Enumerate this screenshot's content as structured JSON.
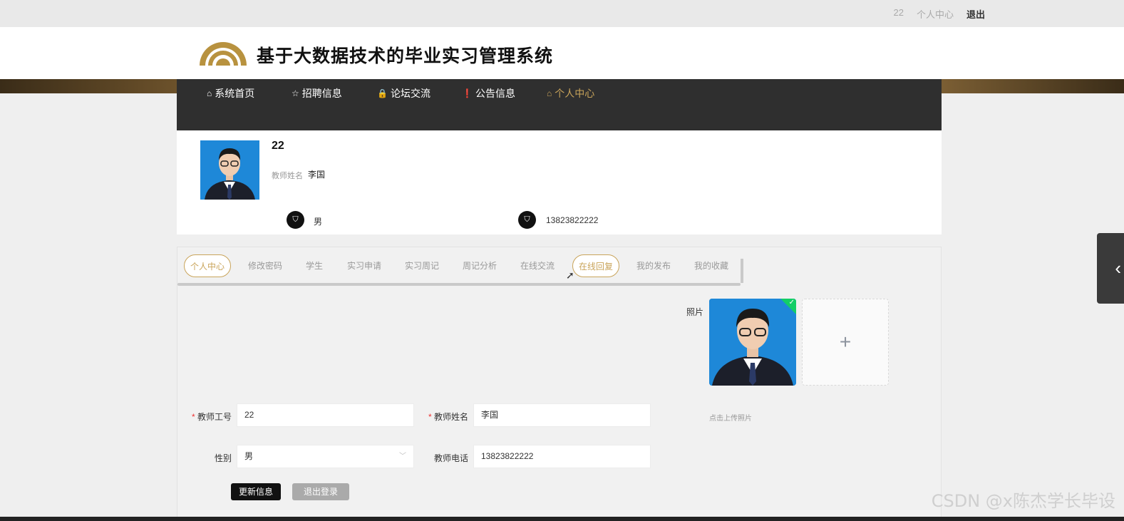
{
  "topbar": {
    "user": "22",
    "center": "个人中心",
    "logout": "退出"
  },
  "header": {
    "title": "基于大数据技术的毕业实习管理系统"
  },
  "nav": [
    {
      "icon": "⌂",
      "label": "系统首页"
    },
    {
      "icon": "☆",
      "label": "招聘信息"
    },
    {
      "icon": "🔒",
      "label": "论坛交流"
    },
    {
      "icon": "❗",
      "label": "公告信息"
    },
    {
      "icon": "⌂",
      "label": "个人中心"
    }
  ],
  "profile": {
    "id": "22",
    "name_label": "教师姓名",
    "name": "李国",
    "gender": "男",
    "phone": "13823822222"
  },
  "tabs": [
    "个人中心",
    "修改密码",
    "学生",
    "实习申请",
    "实习周记",
    "周记分析",
    "在线交流",
    "在线回复",
    "我的发布",
    "我的收藏"
  ],
  "form": {
    "photo_label": "照片",
    "upload_plus": "+",
    "upload_hint": "点击上传照片",
    "id_label": "教师工号",
    "id_value": "22",
    "name_label": "教师姓名",
    "name_value": "李国",
    "gender_label": "性别",
    "gender_value": "男",
    "phone_label": "教师电话",
    "phone_value": "13823822222",
    "required_mark": "*",
    "update_button": "更新信息",
    "logout_button": "退出登录"
  },
  "watermark": "CSDN @x陈杰学长毕设",
  "colors": {
    "accent": "#c9a45a",
    "nav_bg": "#2f2f2f",
    "avatar_bg": "#1e88d8"
  }
}
